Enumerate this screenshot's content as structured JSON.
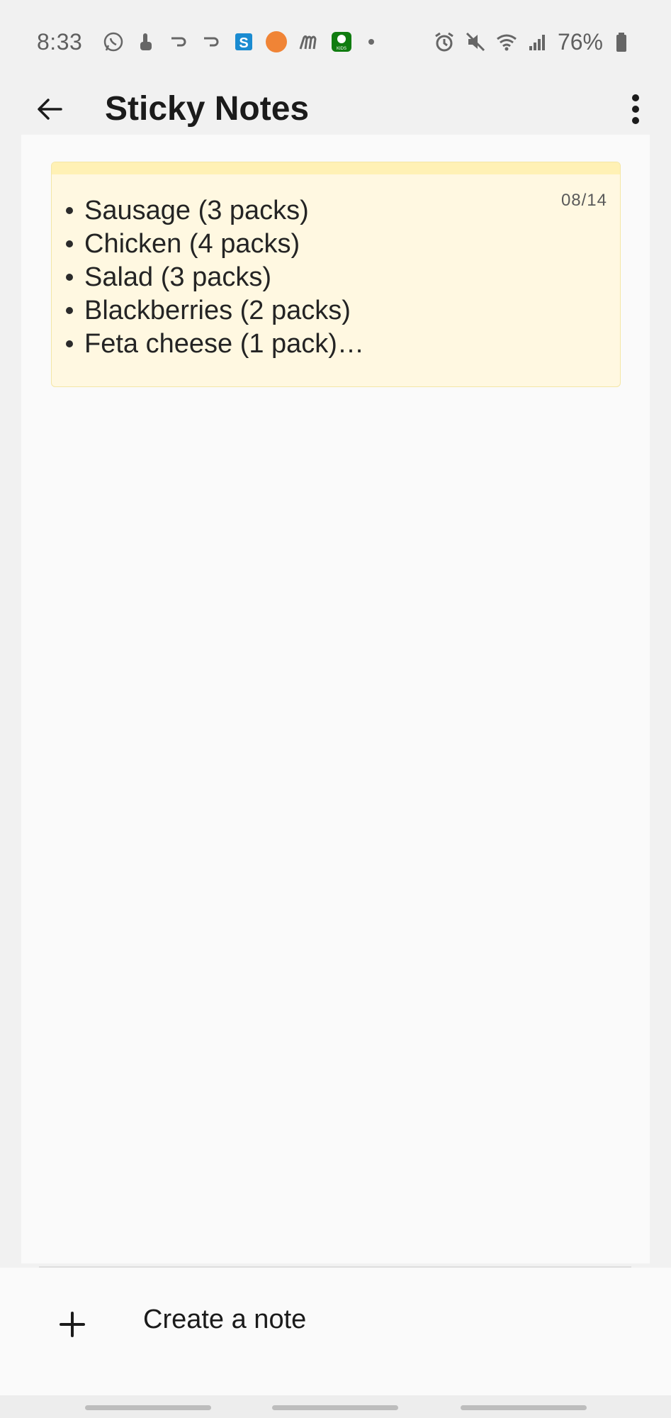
{
  "status_bar": {
    "time": "8:33",
    "battery": "76%",
    "left_icons": [
      "whatsapp-icon",
      "touch-icon",
      "hook-icon",
      "hook-icon",
      "s-app-icon",
      "orange-circle-icon",
      "m-app-icon",
      "xbox-kids-icon",
      "dot-icon"
    ],
    "right_icons": [
      "alarm-icon",
      "mute-icon",
      "wifi-icon",
      "signal-icon",
      "battery-icon"
    ]
  },
  "app_bar": {
    "title": "Sticky Notes",
    "back_icon": "arrow-left-icon",
    "menu_icon": "more-vertical-icon"
  },
  "notes": [
    {
      "date": "08/14",
      "items": [
        "Sausage (3 packs)",
        "Chicken (4 packs)",
        "Salad (3 packs)",
        "Blackberries (2 packs)",
        "Feta cheese (1 pack)…"
      ],
      "color": "#fff8e1",
      "accent": "#fff1b5"
    }
  ],
  "footer": {
    "create_label": "Create a note",
    "create_icon": "plus-icon"
  },
  "colors": {
    "background": "#f1f1f1",
    "content": "#fafafa",
    "note_body": "#fff8e1",
    "note_band": "#fff1b5",
    "text": "#1b1b1b"
  }
}
